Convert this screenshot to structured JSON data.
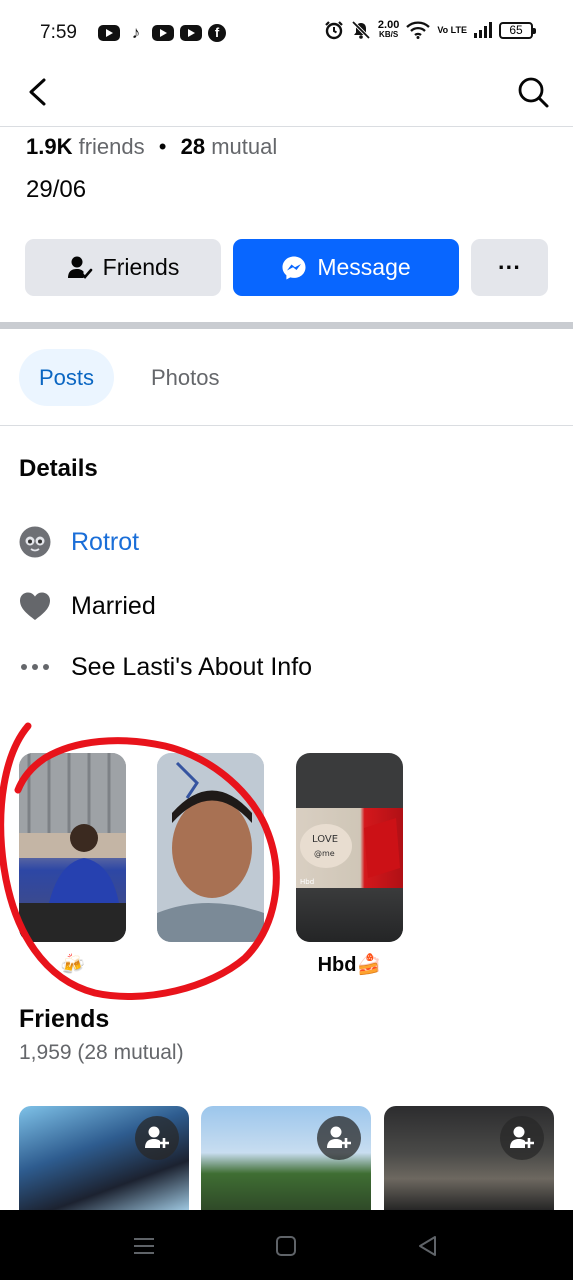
{
  "status_bar": {
    "time": "7:59",
    "net_speed": "2.00",
    "net_unit": "KB/S",
    "volte": "Vo LTE",
    "battery": "65",
    "app_icons": [
      "youtube-icon",
      "tiktok-icon",
      "youtube-icon",
      "youtube-icon",
      "facebook-icon"
    ]
  },
  "profile": {
    "friends_count": "1.9K",
    "friends_word": "friends",
    "mutual_count": "28",
    "mutual_word": "mutual",
    "date": "29/06"
  },
  "actions": {
    "friends_label": "Friends",
    "message_label": "Message",
    "more_label": "···"
  },
  "tabs": [
    {
      "label": "Posts",
      "active": true
    },
    {
      "label": "Photos",
      "active": false
    }
  ],
  "details": {
    "title": "Details",
    "items": [
      {
        "label": "Rotrot",
        "icon": "page-avatar-icon",
        "link": true
      },
      {
        "label": "Married",
        "icon": "heart-icon",
        "link": false
      },
      {
        "label": "See Lasti's About Info",
        "icon": "more-dots-icon",
        "link": false
      }
    ]
  },
  "featured": [
    {
      "label": "🍻"
    },
    {
      "label": ""
    },
    {
      "label": "Hbd🍰"
    }
  ],
  "friends_section": {
    "title": "Friends",
    "count": "1,959 (28 mutual)"
  },
  "colors": {
    "accent": "#0866ff",
    "link": "#1a6ed8",
    "tab_active_bg": "#ebf5ff",
    "annotation_red": "#e8131b"
  }
}
